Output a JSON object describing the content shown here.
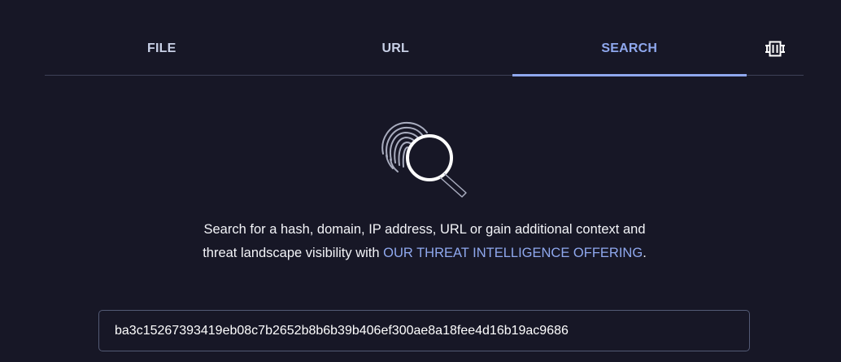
{
  "tabs": [
    {
      "label": "FILE",
      "active": false
    },
    {
      "label": "URL",
      "active": false
    },
    {
      "label": "SEARCH",
      "active": true
    }
  ],
  "tab_icon": "hardware-chip-icon",
  "hero_icon": "fingerprint-search-icon",
  "description": {
    "text_before": "Search for a hash, domain, IP address, URL or gain additional context and threat landscape visibility with ",
    "link_text": "OUR THREAT INTELLIGENCE OFFERING",
    "text_after": "."
  },
  "search": {
    "value": "ba3c15267393419eb08c7b2652b8b6b39b406ef300ae8a18fee4d16b19ac9686",
    "placeholder": ""
  },
  "colors": {
    "background": "#171726",
    "accent": "#8fa8ee",
    "tab_text": "#c8d0e6",
    "divider": "#3d4157"
  }
}
